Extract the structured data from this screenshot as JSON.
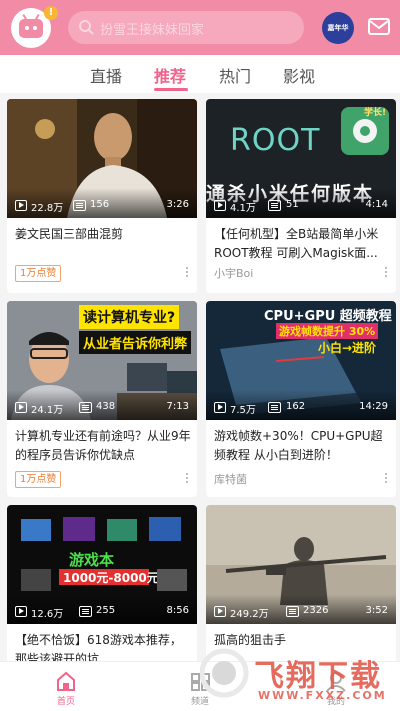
{
  "header": {
    "notification_badge": "!",
    "search_placeholder": "扮雪王接妹妹回家",
    "game_icon_text": "嘉年华"
  },
  "tabs": [
    {
      "label": "直播",
      "active": false
    },
    {
      "label": "推荐",
      "active": true
    },
    {
      "label": "热门",
      "active": false
    },
    {
      "label": "影视",
      "active": false
    }
  ],
  "cards": [
    {
      "views": "22.8万",
      "danmaku": "156",
      "duration": "3:26",
      "title": "姜文民国三部曲混剪",
      "tag": "1万点赞",
      "author": ""
    },
    {
      "views": "4.1万",
      "danmaku": "51",
      "duration": "4:14",
      "title": "【任何机型】全B站最简单小米ROOT教程 可刷入Magisk面...",
      "tag": "",
      "author": "小宇Boi",
      "thumb_text_main": "ROOT",
      "thumb_text_sub": "通杀小米任何版本"
    },
    {
      "views": "24.1万",
      "danmaku": "438",
      "duration": "7:13",
      "title": "计算机专业还有前途吗？从业9年的程序员告诉你优缺点",
      "tag": "1万点赞",
      "author": "",
      "thumb_text_main": "读计算机专业?",
      "thumb_text_sub": "从业者告诉你利弊"
    },
    {
      "views": "7.5万",
      "danmaku": "162",
      "duration": "14:29",
      "title": "游戏帧数+30%！CPU+GPU超频教程 从小白到进阶！",
      "tag": "",
      "author": "库特菌",
      "thumb_text_main": "CPU+GPU 超频教程",
      "thumb_text_sub": "游戏帧数提升 30%",
      "thumb_text_sub2": "小白→进阶"
    },
    {
      "views": "12.6万",
      "danmaku": "255",
      "duration": "8:56",
      "title": "【绝不恰饭】618游戏本推荐，那些该避开的坑..."
    },
    {
      "views": "249.2万",
      "danmaku": "2326",
      "duration": "3:52",
      "title": "孤高的狙击手"
    }
  ],
  "bottom_nav": [
    {
      "label": "首页",
      "active": true
    },
    {
      "label": "频道",
      "active": false
    },
    {
      "label": "我的",
      "active": false
    }
  ],
  "watermark": {
    "text_main": "飞翔下载",
    "text_sub": "WWW.FXXZ.COM"
  },
  "colors": {
    "brand_pink": "#f28ba6",
    "accent": "#f2638c",
    "tag_orange": "#f07b2e"
  }
}
